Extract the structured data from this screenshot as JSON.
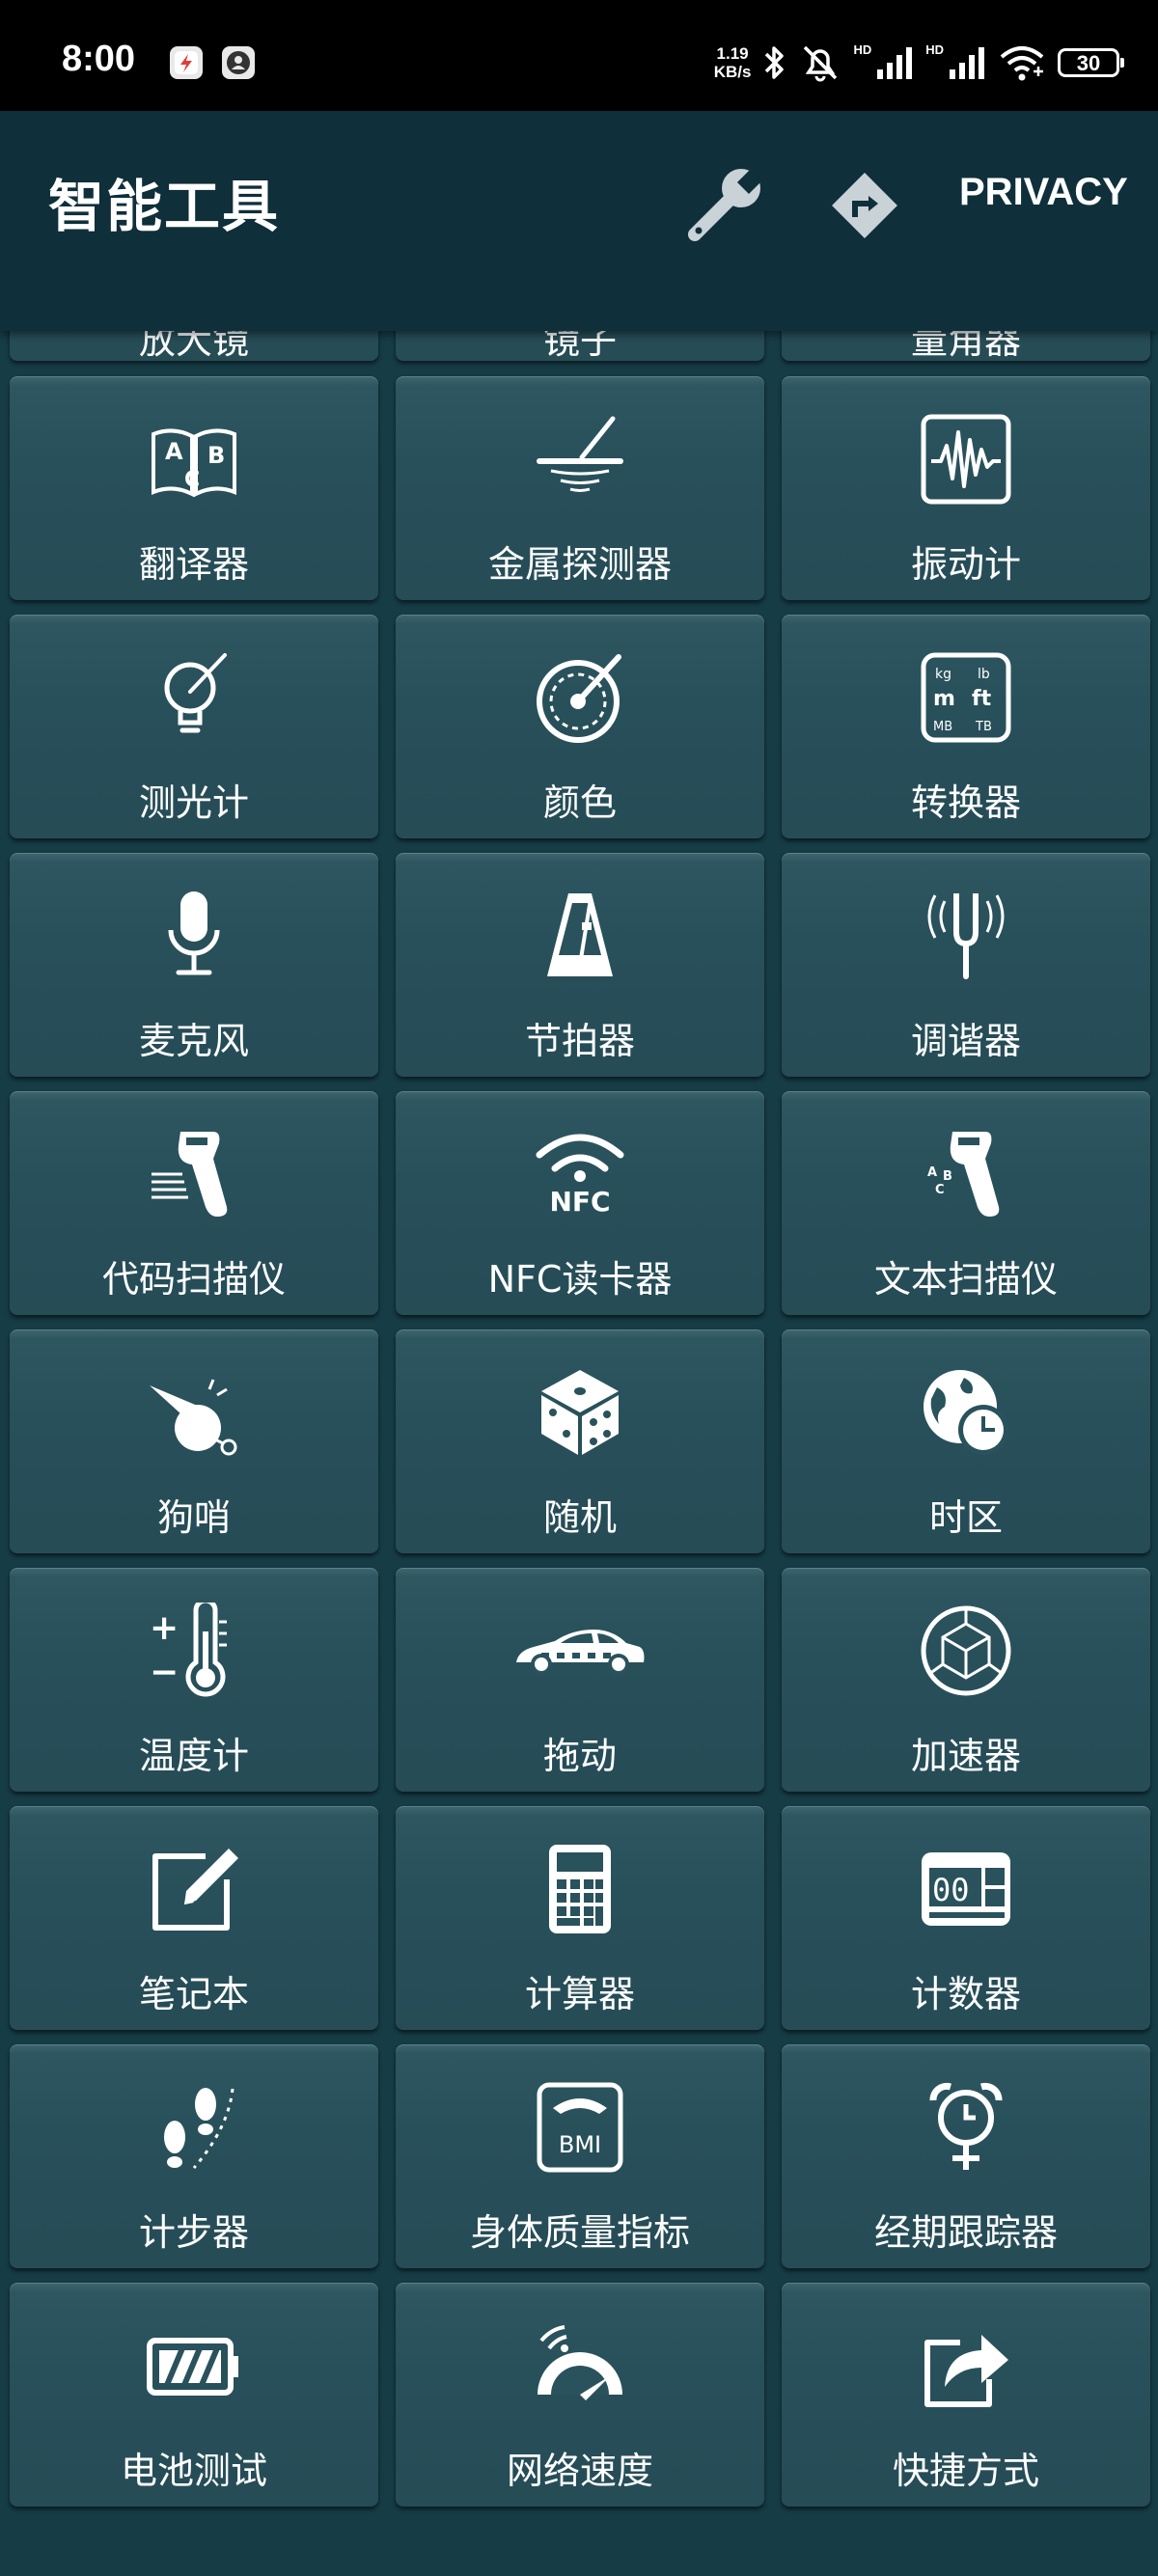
{
  "status_bar": {
    "time": "8:00",
    "net_speed_value": "1.19",
    "net_speed_unit": "KB/s",
    "sim1": "HD",
    "sim2": "HD",
    "battery": "30"
  },
  "app_bar": {
    "title": "智能工具",
    "privacy_label": "PRIVACY"
  },
  "partial_row": [
    {
      "label": "放大镜"
    },
    {
      "label": "镜子"
    },
    {
      "label": "量角器"
    }
  ],
  "tools": [
    {
      "label": "翻译器",
      "icon": "translate-book-icon"
    },
    {
      "label": "金属探测器",
      "icon": "metal-detector-icon"
    },
    {
      "label": "振动计",
      "icon": "vibration-meter-icon"
    },
    {
      "label": "测光计",
      "icon": "light-meter-icon"
    },
    {
      "label": "颜色",
      "icon": "color-wheel-icon"
    },
    {
      "label": "转换器",
      "icon": "unit-converter-icon"
    },
    {
      "label": "麦克风",
      "icon": "microphone-icon"
    },
    {
      "label": "节拍器",
      "icon": "metronome-icon"
    },
    {
      "label": "调谐器",
      "icon": "tuning-fork-icon"
    },
    {
      "label": "代码扫描仪",
      "icon": "barcode-scanner-icon"
    },
    {
      "label": "NFC读卡器",
      "icon": "nfc-icon"
    },
    {
      "label": "文本扫描仪",
      "icon": "text-scanner-icon"
    },
    {
      "label": "狗哨",
      "icon": "whistle-icon"
    },
    {
      "label": "随机",
      "icon": "dice-icon"
    },
    {
      "label": "时区",
      "icon": "globe-clock-icon"
    },
    {
      "label": "温度计",
      "icon": "thermometer-icon"
    },
    {
      "label": "拖动",
      "icon": "tow-car-icon"
    },
    {
      "label": "加速器",
      "icon": "accelerometer-cube-icon"
    },
    {
      "label": "笔记本",
      "icon": "notepad-pen-icon"
    },
    {
      "label": "计算器",
      "icon": "calculator-icon"
    },
    {
      "label": "计数器",
      "icon": "counter-icon"
    },
    {
      "label": "计步器",
      "icon": "footsteps-icon"
    },
    {
      "label": "身体质量指标",
      "icon": "bmi-scale-icon"
    },
    {
      "label": "经期跟踪器",
      "icon": "alarm-female-icon"
    },
    {
      "label": "电池测试",
      "icon": "battery-test-icon"
    },
    {
      "label": "网络速度",
      "icon": "speedometer-icon"
    },
    {
      "label": "快捷方式",
      "icon": "shortcut-share-icon"
    }
  ],
  "icon_text": {
    "translate_a": "A",
    "translate_b": "B",
    "translate_c": "C",
    "unit_kg": "kg",
    "unit_lb": "lb",
    "unit_m": "m",
    "unit_ft": "ft",
    "unit_mb": "MB",
    "unit_tb": "TB",
    "nfc": "NFC",
    "text_a": "A",
    "text_b": "B",
    "text_c": "C",
    "counter_digits": "00",
    "bmi": "BMI",
    "plus": "+",
    "minus": "−"
  },
  "colors": {
    "background": "#163c46",
    "app_bar": "#0f2f3a",
    "tile": "#2a525c",
    "text": "#ffffff"
  }
}
